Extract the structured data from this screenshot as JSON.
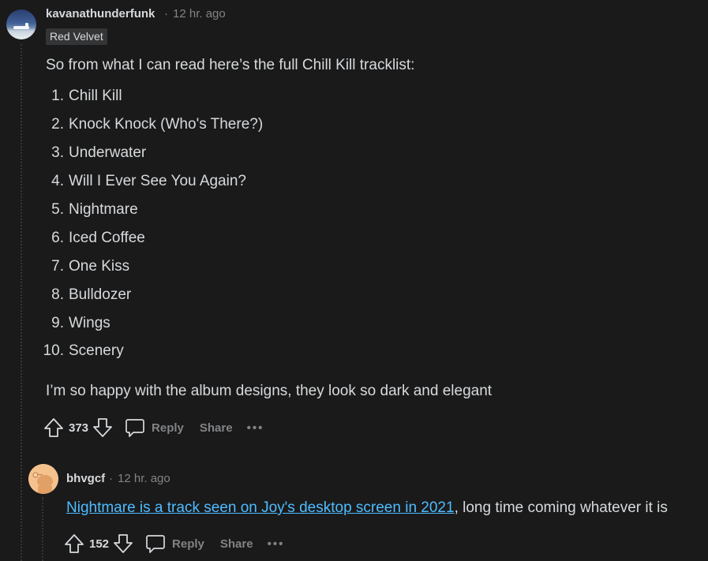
{
  "comment1": {
    "username": "kavanathunderfunk",
    "dot": "·",
    "time": "12 hr. ago",
    "flair": "Red Velvet",
    "intro": "So from what I can read here’s the full Chill Kill tracklist:",
    "tracks": [
      {
        "num": "1.",
        "title": "Chill Kill"
      },
      {
        "num": "2.",
        "title": "Knock Knock (Who's There?)"
      },
      {
        "num": "3.",
        "title": "Underwater"
      },
      {
        "num": "4.",
        "title": "Will I Ever See You Again?"
      },
      {
        "num": "5.",
        "title": "Nightmare"
      },
      {
        "num": "6.",
        "title": "Iced Coffee"
      },
      {
        "num": "7.",
        "title": "One Kiss"
      },
      {
        "num": "8.",
        "title": "Bulldozer"
      },
      {
        "num": "9.",
        "title": "Wings"
      },
      {
        "num": "10.",
        "title": "Scenery"
      }
    ],
    "outro": "I’m so happy with the album designs, they look so dark and elegant",
    "score": "373",
    "reply": "Reply",
    "share": "Share",
    "more": "•••"
  },
  "comment2": {
    "username": "bhvgcf",
    "dot": "·",
    "time": "12 hr. ago",
    "link_text": "Nightmare is a track seen on Joy's desktop screen in 2021",
    "rest_text": ", long time coming whatever it is",
    "score": "152",
    "reply": "Reply",
    "share": "Share",
    "more": "•••"
  },
  "colors": {
    "background": "#1a1a1b",
    "text": "#d7dadc",
    "muted": "#818384",
    "link": "#4fbcff",
    "flair_bg": "#343536"
  },
  "icons": [
    "upvote-icon",
    "downvote-icon",
    "comment-bubble-icon",
    "overflow-dots-icon"
  ]
}
